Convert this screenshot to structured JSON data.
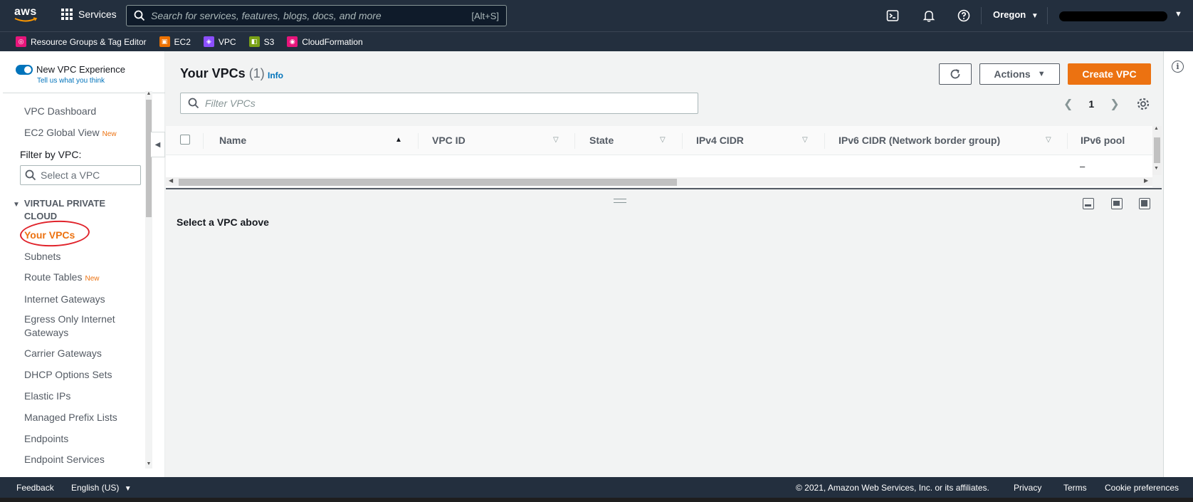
{
  "topnav": {
    "logo_text": "aws",
    "services_label": "Services",
    "search_placeholder": "Search for services, features, blogs, docs, and more",
    "search_shortcut": "[Alt+S]",
    "region": "Oregon"
  },
  "favorites": [
    {
      "label": "Resource Groups & Tag Editor",
      "color": "#e7157b"
    },
    {
      "label": "EC2",
      "color": "#ed7100"
    },
    {
      "label": "VPC",
      "color": "#8c4fff"
    },
    {
      "label": "S3",
      "color": "#7aa116"
    },
    {
      "label": "CloudFormation",
      "color": "#e7157b"
    }
  ],
  "sidebar": {
    "experience_toggle": "New VPC Experience",
    "feedback_link": "Tell us what you think",
    "items_top": [
      {
        "label": "VPC Dashboard",
        "badge": ""
      },
      {
        "label": "EC2 Global View",
        "badge": "New"
      }
    ],
    "filter_label": "Filter by VPC:",
    "filter_placeholder": "Select a VPC",
    "section_title_1": "VIRTUAL PRIVATE",
    "section_title_2": "CLOUD",
    "active_item": "Your VPCs",
    "items": [
      {
        "label": "Subnets",
        "badge": ""
      },
      {
        "label": "Route Tables",
        "badge": "New"
      },
      {
        "label": "Internet Gateways",
        "badge": ""
      },
      {
        "label": "Egress Only Internet",
        "badge": ""
      },
      {
        "label": "Gateways",
        "badge": ""
      },
      {
        "label": "Carrier Gateways",
        "badge": ""
      },
      {
        "label": "DHCP Options Sets",
        "badge": ""
      },
      {
        "label": "Elastic IPs",
        "badge": ""
      },
      {
        "label": "Managed Prefix Lists",
        "badge": ""
      },
      {
        "label": "Endpoints",
        "badge": ""
      },
      {
        "label": "Endpoint Services",
        "badge": ""
      }
    ]
  },
  "header": {
    "title": "Your VPCs",
    "count": "(1)",
    "info": "Info",
    "actions_label": "Actions",
    "create_label": "Create VPC",
    "filter_placeholder": "Filter VPCs",
    "page_number": "1"
  },
  "table": {
    "columns": [
      "Name",
      "VPC ID",
      "State",
      "IPv4 CIDR",
      "IPv6 CIDR (Network border group)",
      "IPv6 pool"
    ],
    "row_ipv6_pool": "–"
  },
  "detail": {
    "empty_message": "Select a VPC above"
  },
  "footer": {
    "feedback": "Feedback",
    "language": "English (US)",
    "copyright": "© 2021, Amazon Web Services, Inc. or its affiliates.",
    "privacy": "Privacy",
    "terms": "Terms",
    "cookies": "Cookie preferences"
  },
  "colors": {
    "nav_bg": "#232f3e",
    "accent_orange": "#ec7211",
    "link_blue": "#0073bb",
    "annotation_red": "#e0232b"
  }
}
